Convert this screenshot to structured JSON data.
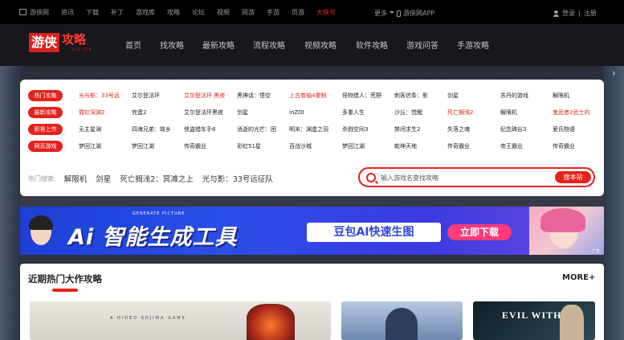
{
  "topbar": {
    "links": [
      "游侠网",
      "资讯",
      "下载",
      "补丁",
      "游戏库",
      "攻略",
      "论坛",
      "视频",
      "网游",
      "手游",
      "页游"
    ],
    "highlight": "大侠号",
    "more": "更多",
    "app": "游侠网APP",
    "login": "登录",
    "separator": "|",
    "register": "注册"
  },
  "header": {
    "logo_main": "游侠",
    "logo_text": "攻略",
    "logo_sub": "GUIDE",
    "nav": [
      "首页",
      "找攻略",
      "最新攻略",
      "流程攻略",
      "视频攻略",
      "软件攻略",
      "游戏问答",
      "手游攻略"
    ]
  },
  "panel": {
    "rows": [
      {
        "label": "热门攻略",
        "items": [
          {
            "text": "光与影：33号远",
            "red": true
          },
          {
            "text": "艾尔登法环",
            "red": false
          },
          {
            "text": "艾尔登法环 黑夜",
            "red": true
          },
          {
            "text": "黑神话：悟空",
            "red": false
          },
          {
            "text": "上古卷轴4重制",
            "red": true
          },
          {
            "text": "怪物猎人：荒野",
            "red": false
          },
          {
            "text": "刺客信条：影",
            "red": false
          },
          {
            "text": "剑星",
            "red": false
          },
          {
            "text": "苏丹的游戏",
            "red": false
          },
          {
            "text": "解限机",
            "red": false
          }
        ]
      },
      {
        "label": "最新攻略",
        "items": [
          {
            "text": "霓虹深渊2",
            "red": true
          },
          {
            "text": "完蛋2",
            "red": false
          },
          {
            "text": "艾尔登法环黑夜",
            "red": false
          },
          {
            "text": "剑星",
            "red": false
          },
          {
            "text": "inZOI",
            "red": false
          },
          {
            "text": "多重人生",
            "red": false
          },
          {
            "text": "沙丘：觉醒",
            "red": false
          },
          {
            "text": "死亡搁浅2",
            "red": true
          },
          {
            "text": "解限机",
            "red": false
          },
          {
            "text": "鬼武者2武士的",
            "red": true
          }
        ]
      },
      {
        "label": "即将上市",
        "items": [
          {
            "text": "无主星渊",
            "red": false
          },
          {
            "text": "四海兄弟：故乡",
            "red": false
          },
          {
            "text": "侠盗猎车手6",
            "red": false
          },
          {
            "text": "消逝的光芒：困",
            "red": false
          },
          {
            "text": "明末：渊虚之羽",
            "red": false
          },
          {
            "text": "杀戮空间3",
            "red": false
          },
          {
            "text": "禁闭求生2",
            "red": false
          },
          {
            "text": "失落之魂",
            "red": false
          },
          {
            "text": "纪念碑谷3",
            "red": false
          },
          {
            "text": "爱氏物语",
            "red": false
          }
        ]
      },
      {
        "label": "网页游戏",
        "items": [
          {
            "text": "梦回江湖",
            "red": false
          },
          {
            "text": "梦回江湖",
            "red": false
          },
          {
            "text": "传奇霸业",
            "red": false
          },
          {
            "text": "彩虹51星",
            "red": false
          },
          {
            "text": "百战沙城",
            "red": false
          },
          {
            "text": "梦回江湖",
            "red": false
          },
          {
            "text": "乾坤天地",
            "red": false
          },
          {
            "text": "传奇霸业",
            "red": false
          },
          {
            "text": "帝王霸业",
            "red": false
          },
          {
            "text": "传奇霸业",
            "red": false
          }
        ]
      }
    ],
    "hot_label": "热门搜索:",
    "hot_keywords": [
      "解限机",
      "剑星",
      "死亡搁浅2：冥滩之上",
      "光与影：33号远征队"
    ],
    "search_placeholder": "输入游戏名查找攻略",
    "search_button": "搜本站"
  },
  "banner": {
    "generate": "GENERATE PICTURE",
    "headline": "Ai 智能生成工具",
    "tag": "豆包AI快速生图",
    "cta": "立即下载",
    "ad": "广告"
  },
  "recent": {
    "title": "近期热门大作攻略",
    "more": "MORE+",
    "card1_caption": "A HIDEO KOJIMA GAME",
    "card3_logo": "EVIL WITHIN"
  },
  "colors": {
    "accent": "#e4231c",
    "topbar_bg": "#000000",
    "header_bg": "#17171c"
  }
}
